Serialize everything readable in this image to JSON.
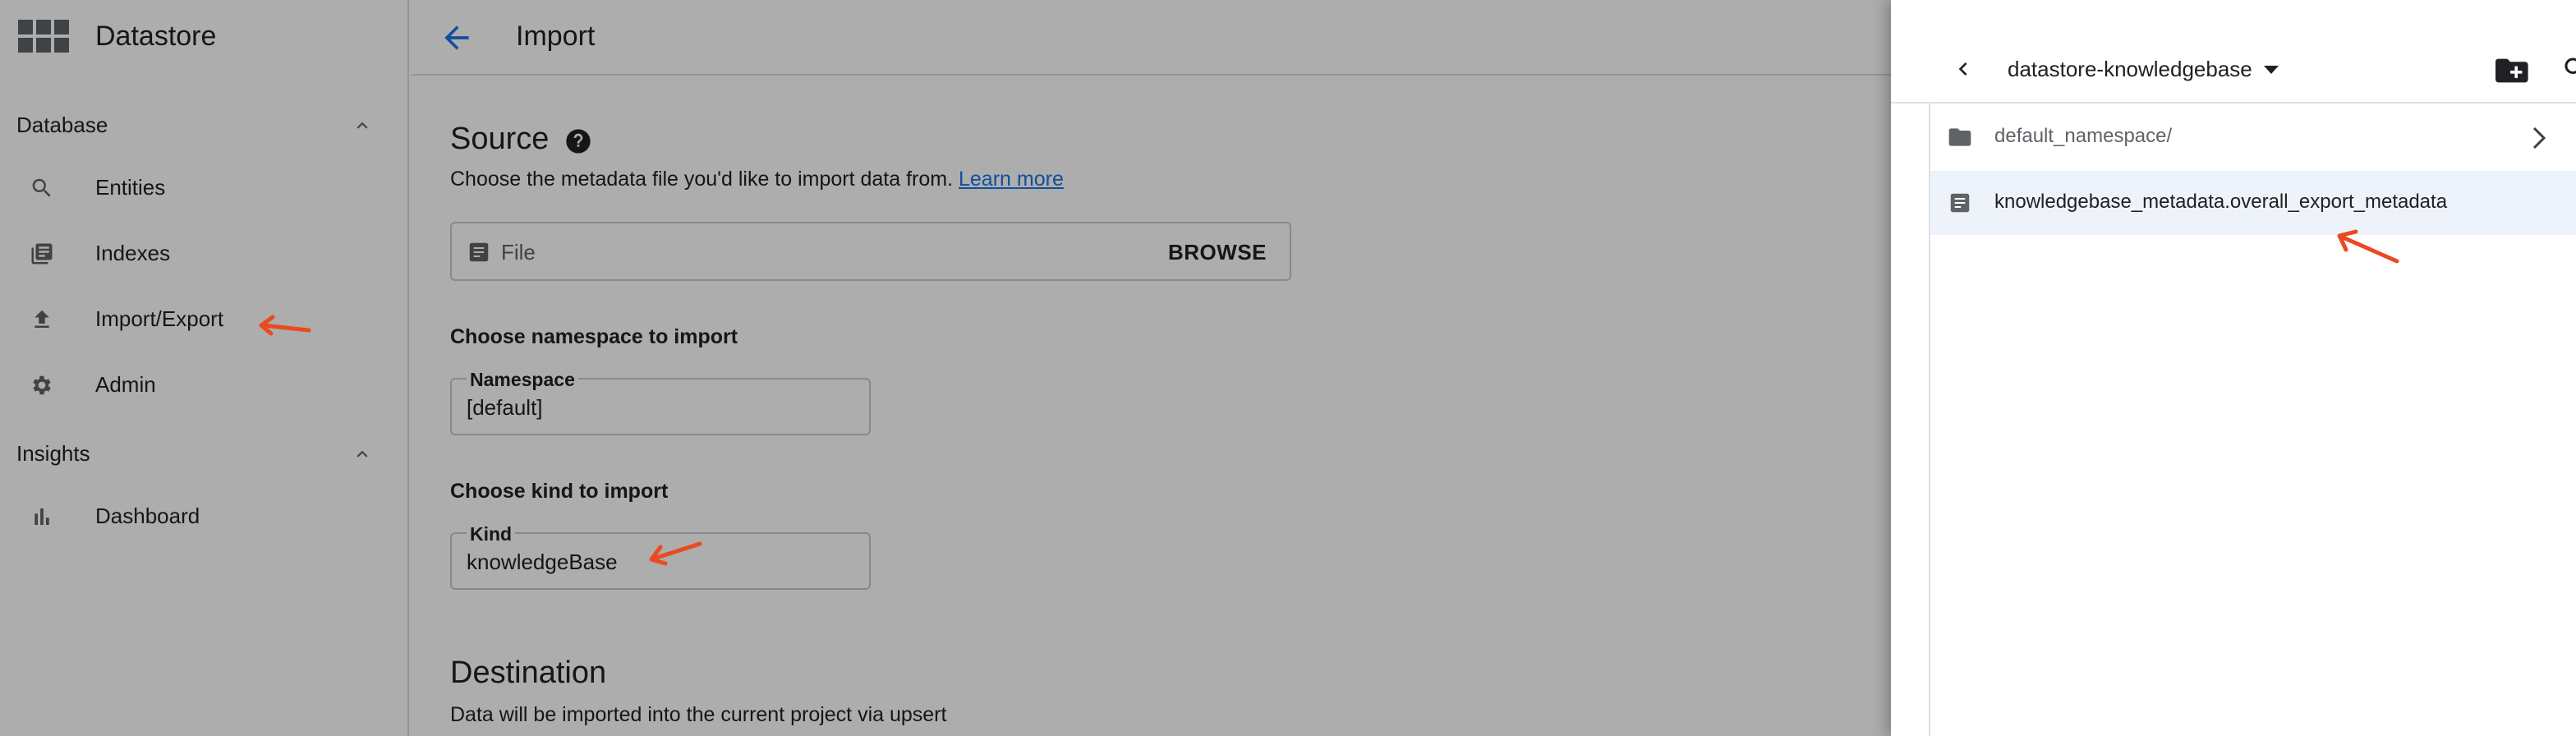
{
  "app": {
    "title": "Datastore",
    "grid_icon": "apps-grid-icon"
  },
  "sidebar": {
    "sections": [
      {
        "label": "Database",
        "chevron": "chevron-up-icon",
        "items": [
          {
            "label": "Entities",
            "icon": "search-icon"
          },
          {
            "label": "Indexes",
            "icon": "indexes-icon"
          },
          {
            "label": "Import/Export",
            "icon": "upload-icon"
          },
          {
            "label": "Admin",
            "icon": "gear-icon"
          }
        ]
      },
      {
        "label": "Insights",
        "chevron": "chevron-up-icon",
        "items": [
          {
            "label": "Dashboard",
            "icon": "bar-chart-icon"
          }
        ]
      }
    ]
  },
  "topbar": {
    "title": "Import",
    "back_icon": "arrow-back-icon"
  },
  "source": {
    "heading": "Source",
    "help_icon": "help-icon",
    "description": "Choose the metadata file you'd like to import data from.",
    "learn_more": "Learn more",
    "file_placeholder": "File",
    "browse_label": "BROWSE"
  },
  "namespace": {
    "title": "Choose namespace to import",
    "label": "Namespace",
    "value": "[default]"
  },
  "kind": {
    "title": "Choose kind to import",
    "label": "Kind",
    "value": "knowledgeBase"
  },
  "destination": {
    "heading": "Destination",
    "description": "Data will be imported into the current project via upsert"
  },
  "picker": {
    "back_icon": "chevron-left-icon",
    "bucket": "datastore-knowledgebase",
    "dropdown_icon": "caret-down-icon",
    "new_folder_icon": "create-new-folder-icon",
    "search_icon": "search-icon",
    "rows": [
      {
        "label": "default_namespace/",
        "icon": "folder-icon",
        "chevron": "chevron-right-icon",
        "selected": false
      },
      {
        "label": "knowledgebase_metadata.overall_export_metadata",
        "icon": "file-icon",
        "selected": true
      }
    ]
  },
  "colors": {
    "accent": "#1a73e8",
    "annotation": "#ea4a1f",
    "scrim": "rgba(0,0,0,0.32)",
    "selected_row": "#eef3fb"
  }
}
